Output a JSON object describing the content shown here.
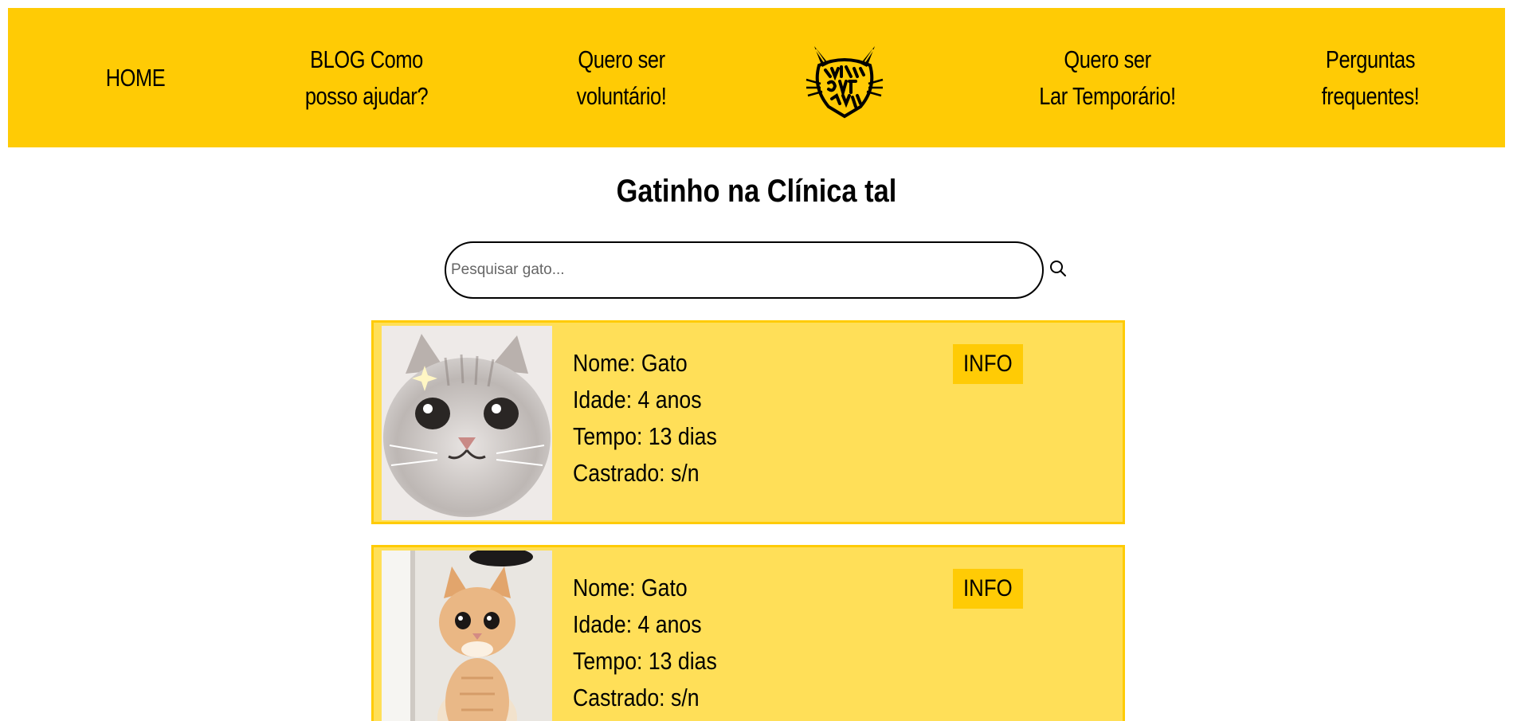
{
  "nav": {
    "home": "HOME",
    "blog_line1": "BLOG Como",
    "blog_line2": "posso ajudar?",
    "volunteer_line1": "Quero ser",
    "volunteer_line2": "voluntário!",
    "foster_line1": "Quero ser",
    "foster_line2": "Lar Temporário!",
    "faq_line1": "Perguntas",
    "faq_line2": "frequentes!",
    "logo_text": "CRAZY CAT GANG"
  },
  "page_title": "Gatinho na Clínica tal",
  "search": {
    "placeholder": "Pesquisar gato...",
    "icon": "search-icon"
  },
  "cats": [
    {
      "nome": "Nome: Gato",
      "idade": "Idade: 4 anos",
      "tempo": "Tempo: 13 dias",
      "castrado": "Castrado: s/n",
      "info_label": "INFO",
      "photo": "gray-cat-photo"
    },
    {
      "nome": "Nome: Gato",
      "idade": "Idade: 4 anos",
      "tempo": "Tempo: 13 dias",
      "castrado": "Castrado: s/n",
      "info_label": "INFO",
      "photo": "orange-kitten-photo"
    }
  ],
  "colors": {
    "nav_bg": "#ffcb05",
    "card_bg": "#ffdf58",
    "card_border": "#ffcb05",
    "button_bg": "#ffcb05"
  }
}
